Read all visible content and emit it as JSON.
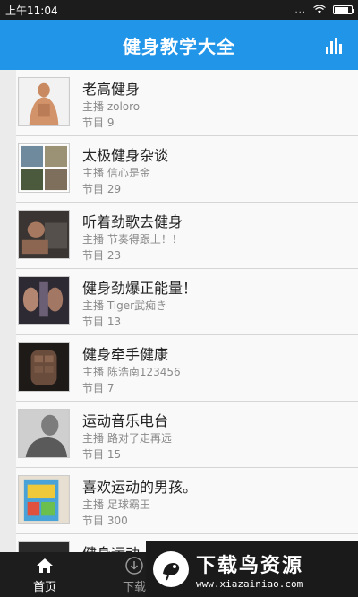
{
  "status_bar": {
    "time": "上午11:04",
    "dots": "...",
    "battery_level": 0.85
  },
  "app_bar": {
    "title": "健身教学大全",
    "action_icon": "bar-chart-icon"
  },
  "programs": [
    {
      "title": "老高健身",
      "host": "主播 zoloro",
      "count": "节目 9"
    },
    {
      "title": "太极健身杂谈",
      "host": "主播 信心是金",
      "count": "节目 29"
    },
    {
      "title": "听着劲歌去健身",
      "host": "主播 节奏得跟上！！",
      "count": "节目 23"
    },
    {
      "title": "健身劲爆正能量！",
      "host": "主播 Tiger武痴き",
      "count": "节目 13"
    },
    {
      "title": "健身牵手健康",
      "host": "主播 陈浩南123456",
      "count": "节目 7"
    },
    {
      "title": "运动音乐电台",
      "host": "主播 路对了走再远",
      "count": "节目 15"
    },
    {
      "title": "喜欢运动的男孩。",
      "host": "主播 足球霸王",
      "count": "节目 300"
    },
    {
      "title": "健身运动",
      "host": "",
      "count": ""
    }
  ],
  "bottom_nav": {
    "items": [
      {
        "label": "首页",
        "icon": "home-icon",
        "active": true
      },
      {
        "label": "下载",
        "icon": "download-icon",
        "active": false
      }
    ]
  },
  "watermark": {
    "brand": "下载鸟资源",
    "url": "www.xiazainiao.com"
  },
  "colors": {
    "app_bar": "#2196e9",
    "nav_bg": "#1d1d1d"
  }
}
